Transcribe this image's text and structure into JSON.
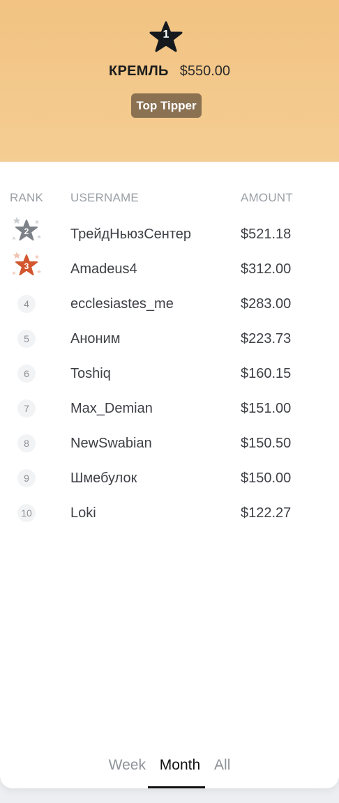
{
  "top": {
    "rank": "1",
    "name": "КРЕМЛЬ",
    "amount": "$550.00",
    "badge": "Top Tipper"
  },
  "columns": {
    "rank": "RANK",
    "username": "USERNAME",
    "amount": "AMOUNT"
  },
  "rows": [
    {
      "rank": "2",
      "username": "ТрейдНьюзСентер",
      "amount": "$521.18"
    },
    {
      "rank": "3",
      "username": "Amadeus4",
      "amount": "$312.00"
    },
    {
      "rank": "4",
      "username": "ecclesiastes_me",
      "amount": "$283.00"
    },
    {
      "rank": "5",
      "username": "Аноним",
      "amount": "$223.73"
    },
    {
      "rank": "6",
      "username": "Toshiq",
      "amount": "$160.15"
    },
    {
      "rank": "7",
      "username": "Max_Demian",
      "amount": "$151.00"
    },
    {
      "rank": "8",
      "username": "NewSwabian",
      "amount": "$150.50"
    },
    {
      "rank": "9",
      "username": "Шмебулок",
      "amount": "$150.00"
    },
    {
      "rank": "10",
      "username": "Loki",
      "amount": "$122.27"
    }
  ],
  "tabs": {
    "week": "Week",
    "month": "Month",
    "all": "All",
    "active": "Month"
  },
  "colors": {
    "hero_bg": "#f2c382",
    "badge_bg": "#8a7152",
    "rank2": "#7d8288",
    "rank3": "#d2562e"
  }
}
